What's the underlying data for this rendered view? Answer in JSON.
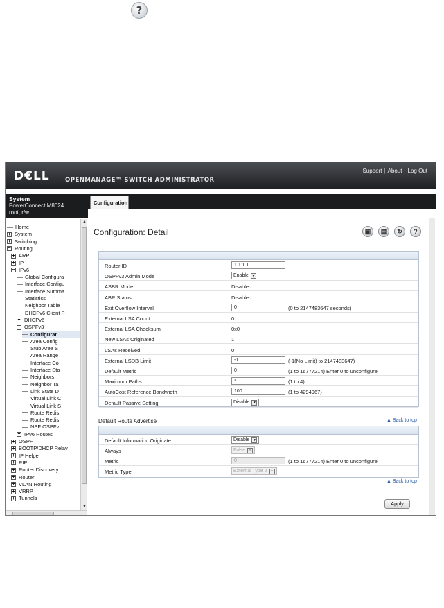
{
  "banner": {
    "logo": "D€LL",
    "product": "OPENMANAGE™ SWITCH ADMINISTRATOR",
    "links": [
      "Support",
      "About",
      "Log Out"
    ]
  },
  "system": {
    "title": "System",
    "model": "PowerConnect M8024",
    "user": "root, r/w"
  },
  "tabs": [
    "Configuration"
  ],
  "tree": [
    {
      "label": "Home",
      "level": 0,
      "type": "home"
    },
    {
      "label": "System",
      "level": 0,
      "type": "plus"
    },
    {
      "label": "Switching",
      "level": 0,
      "type": "plus"
    },
    {
      "label": "Routing",
      "level": 0,
      "type": "minus"
    },
    {
      "label": "ARP",
      "level": 1,
      "type": "plus"
    },
    {
      "label": "IP",
      "level": 1,
      "type": "plus"
    },
    {
      "label": "IPv6",
      "level": 1,
      "type": "minus"
    },
    {
      "label": "Global Configura",
      "level": 2,
      "type": "leaf"
    },
    {
      "label": "Interface Configu",
      "level": 2,
      "type": "leaf"
    },
    {
      "label": "Interface Summa",
      "level": 2,
      "type": "leaf"
    },
    {
      "label": "Statistics",
      "level": 2,
      "type": "leaf"
    },
    {
      "label": "Neighbor Table",
      "level": 2,
      "type": "leaf"
    },
    {
      "label": "DHCPv6 Client P",
      "level": 2,
      "type": "leaf"
    },
    {
      "label": "DHCPv6",
      "level": 2,
      "type": "plus"
    },
    {
      "label": "OSPFv3",
      "level": 2,
      "type": "minus"
    },
    {
      "label": "Configurat",
      "level": 3,
      "type": "leaf",
      "selected": true
    },
    {
      "label": "Area Config",
      "level": 3,
      "type": "leaf"
    },
    {
      "label": "Stub Area S",
      "level": 3,
      "type": "leaf"
    },
    {
      "label": "Area Range",
      "level": 3,
      "type": "leaf"
    },
    {
      "label": "Interface Co",
      "level": 3,
      "type": "leaf"
    },
    {
      "label": "Interface Sta",
      "level": 3,
      "type": "leaf"
    },
    {
      "label": "Neighbors",
      "level": 3,
      "type": "leaf"
    },
    {
      "label": "Neighbor Ta",
      "level": 3,
      "type": "leaf"
    },
    {
      "label": "Link State D",
      "level": 3,
      "type": "leaf"
    },
    {
      "label": "Virtual Link C",
      "level": 3,
      "type": "leaf"
    },
    {
      "label": "Virtual Link S",
      "level": 3,
      "type": "leaf"
    },
    {
      "label": "Route Redis",
      "level": 3,
      "type": "leaf"
    },
    {
      "label": "Route Redis",
      "level": 3,
      "type": "leaf"
    },
    {
      "label": "NSF OSPFv",
      "level": 3,
      "type": "leaf"
    },
    {
      "label": "IPv6 Routes",
      "level": 2,
      "type": "plus"
    },
    {
      "label": "OSPF",
      "level": 1,
      "type": "plus"
    },
    {
      "label": "BOOTP/DHCP Relay",
      "level": 1,
      "type": "plus"
    },
    {
      "label": "IP Helper",
      "level": 1,
      "type": "plus"
    },
    {
      "label": "RIP",
      "level": 1,
      "type": "plus"
    },
    {
      "label": "Router Discovery",
      "level": 1,
      "type": "plus"
    },
    {
      "label": "Router",
      "level": 1,
      "type": "plus"
    },
    {
      "label": "VLAN Routing",
      "level": 1,
      "type": "plus"
    },
    {
      "label": "VRRP",
      "level": 1,
      "type": "plus"
    },
    {
      "label": "Tunnels",
      "level": 1,
      "type": "plus"
    }
  ],
  "page": {
    "title": "Configuration: Detail"
  },
  "main_rows": [
    {
      "label": "Router ID",
      "kind": "input",
      "value": "1.1.1.1"
    },
    {
      "label": "OSPFv3 Admin Mode",
      "kind": "select",
      "value": "Enable"
    },
    {
      "label": "ASBR Mode",
      "kind": "text",
      "value": "Disabled"
    },
    {
      "label": "ABR Status",
      "kind": "text",
      "value": "Disabled"
    },
    {
      "label": "Exit Overflow Interval",
      "kind": "input",
      "value": "0",
      "hint": "(0 to 2147483647 seconds)"
    },
    {
      "label": "External LSA Count",
      "kind": "text",
      "value": "0"
    },
    {
      "label": "External LSA Checksum",
      "kind": "text",
      "value": "0x0"
    },
    {
      "label": "New LSAs Originated",
      "kind": "text",
      "value": "1"
    },
    {
      "label": "LSAs Received",
      "kind": "text",
      "value": "0"
    },
    {
      "label": "External LSDB Limit",
      "kind": "input",
      "value": "-1",
      "hint": "(-1(No Limit) to 2147483647)"
    },
    {
      "label": "Default Metric",
      "kind": "input",
      "value": "0",
      "hint": "(1 to 16777214) Enter 0 to unconfigure"
    },
    {
      "label": "Maximum Paths",
      "kind": "input",
      "value": "4",
      "hint": "(1 to 4)"
    },
    {
      "label": "AutoCost Reference Bandwidth",
      "kind": "input",
      "value": "100",
      "hint": "(1 to 4294967)"
    },
    {
      "label": "Default Passive Setting",
      "kind": "select",
      "value": "Disable"
    }
  ],
  "section2": {
    "title": "Default Route Advertise",
    "back_label": "▲ Back to top",
    "rows": [
      {
        "label": "Default Information Originate",
        "kind": "select",
        "value": "Disable"
      },
      {
        "label": "Always",
        "kind": "select-dis",
        "value": "False"
      },
      {
        "label": "Metric",
        "kind": "input-dis",
        "value": "0",
        "hint": "(1 to 16777214) Enter 0 to unconfigure"
      },
      {
        "label": "Metric Type",
        "kind": "select-dis",
        "value": "External Type 2"
      }
    ]
  },
  "apply_label": "Apply",
  "help_glyph": "?"
}
